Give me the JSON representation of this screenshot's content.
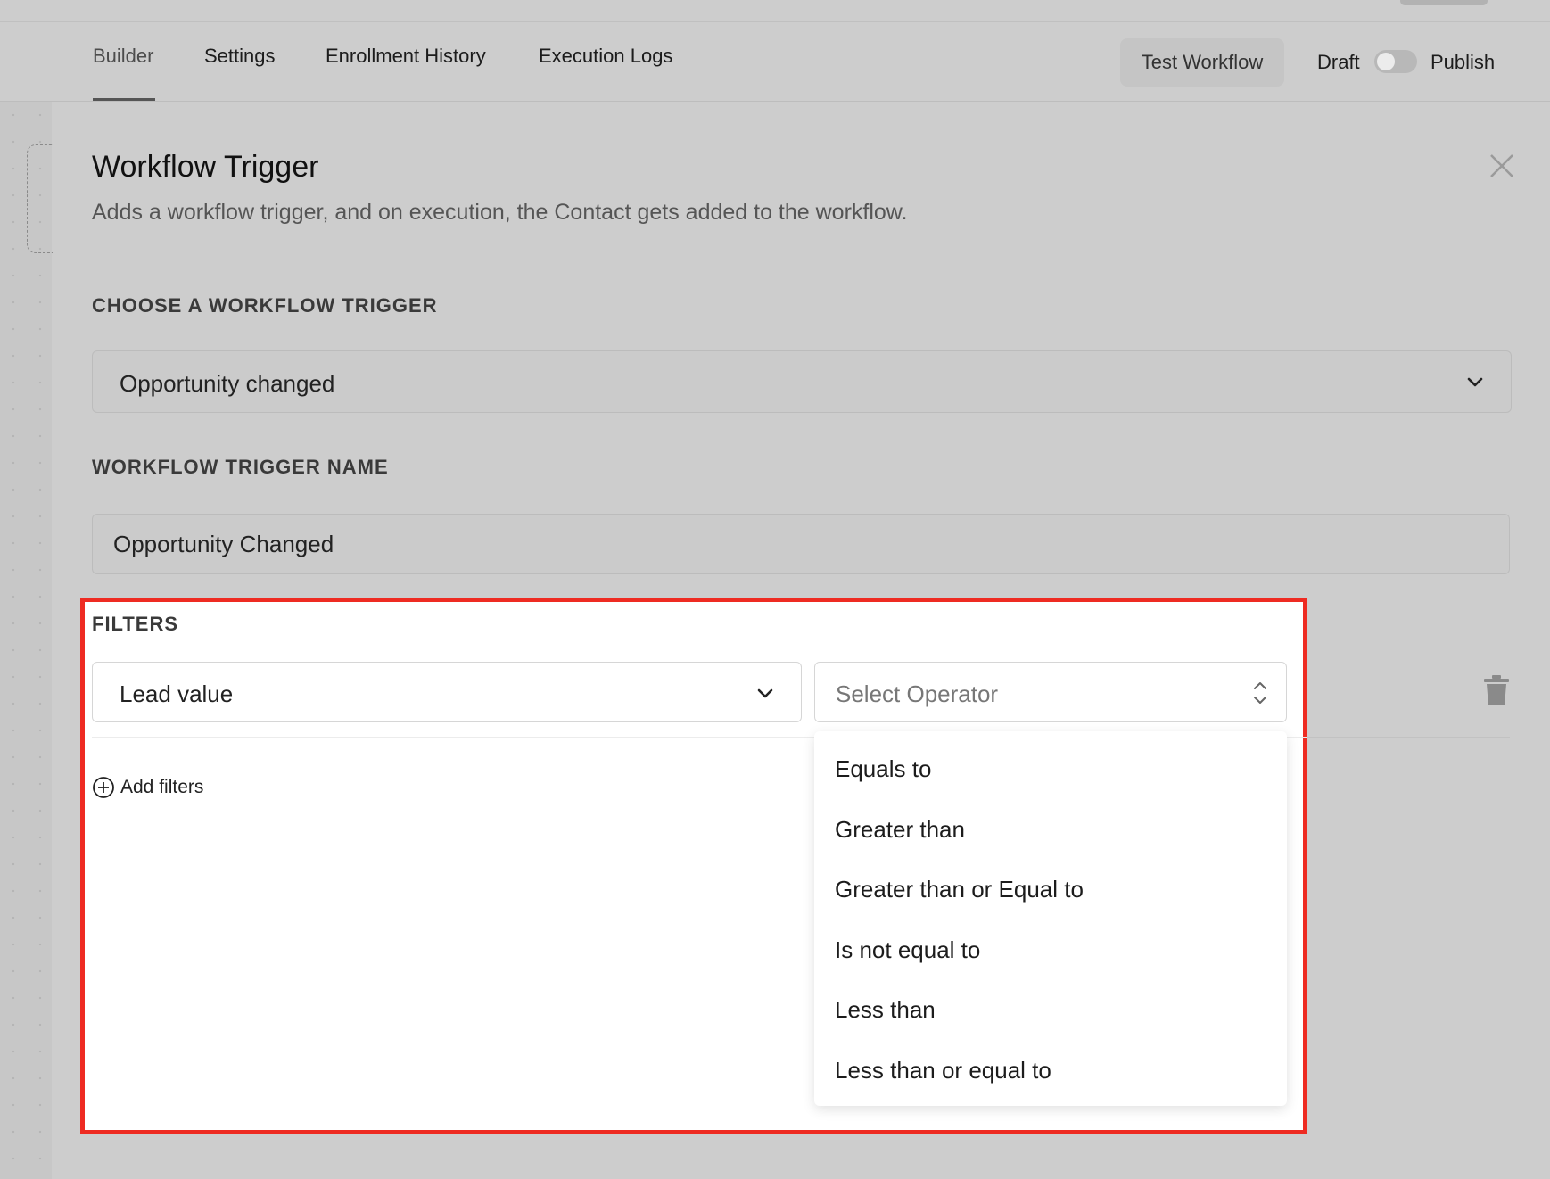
{
  "nav": {
    "tabs": [
      {
        "label": "Builder",
        "active": true
      },
      {
        "label": "Settings"
      },
      {
        "label": "Enrollment History"
      },
      {
        "label": "Execution Logs"
      }
    ],
    "test_workflow_label": "Test Workflow",
    "draft_label": "Draft",
    "publish_label": "Publish",
    "publish_toggle_on": false
  },
  "panel": {
    "title": "Workflow Trigger",
    "description": "Adds a workflow trigger, and on execution, the Contact gets added to the workflow.",
    "trigger_section_label": "CHOOSE A WORKFLOW TRIGGER",
    "trigger_value": "Opportunity changed",
    "name_section_label": "WORKFLOW TRIGGER NAME",
    "name_value": "Opportunity Changed"
  },
  "filters": {
    "label": "FILTERS",
    "field_value": "Lead value",
    "operator_placeholder": "Select Operator",
    "add_label": "Add filters",
    "operator_options": [
      "Equals to",
      "Greater than",
      "Greater than or Equal to",
      "Is not equal to",
      "Less than",
      "Less than or equal to"
    ]
  },
  "colors": {
    "highlight_border": "#ee2b22",
    "overlay_background": "#cdcdcd"
  }
}
